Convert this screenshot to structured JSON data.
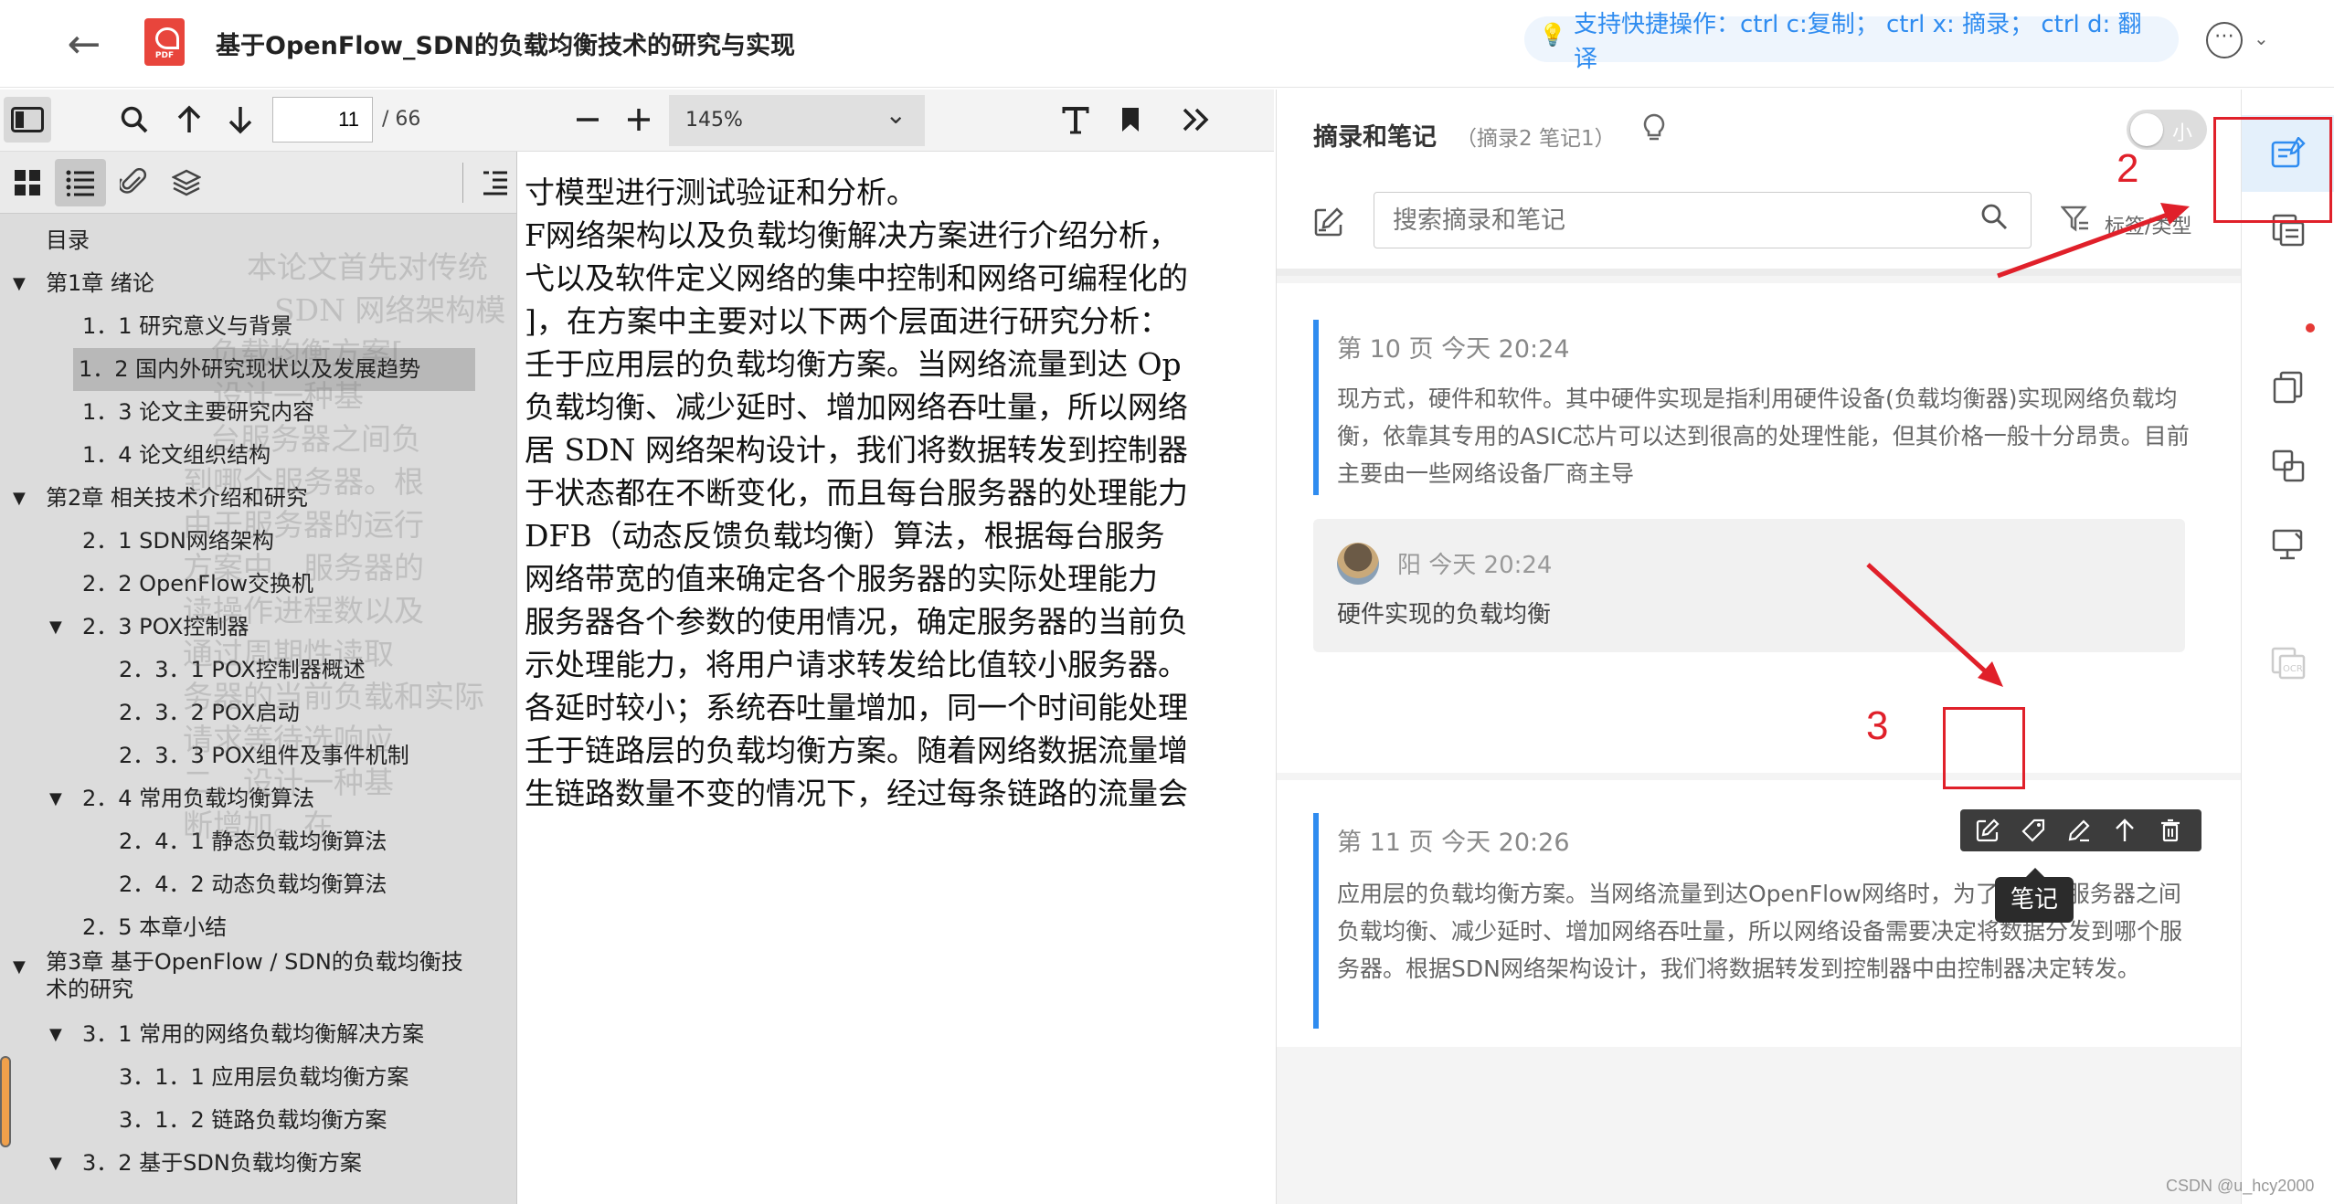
{
  "topbar": {
    "back_label": "←",
    "pdf_badge": "PDF",
    "title": "基于OpenFlow_SDN的负载均衡技术的研究与实现",
    "hint": "支持快捷操作：ctrl c:复制； ctrl x: 摘录； ctrl d: 翻译",
    "more_label": "⋯"
  },
  "pdf_toolbar": {
    "current_page": "11",
    "total_pages": "/ 66",
    "zoom": "145%"
  },
  "toc": {
    "heading": "目录",
    "items": [
      {
        "label": "第1章 绪论",
        "level": 0,
        "caret": "▼"
      },
      {
        "label": "1．1 研究意义与背景",
        "level": 1,
        "caret": ""
      },
      {
        "label": "1．2 国内外研究现状以及发展趋势",
        "level": 1,
        "caret": "",
        "active": true
      },
      {
        "label": "1．3 论文主要研究内容",
        "level": 1,
        "caret": ""
      },
      {
        "label": "1．4 论文组织结构",
        "level": 1,
        "caret": ""
      },
      {
        "label": "第2章 相关技术介绍和研究",
        "level": 0,
        "caret": "▼"
      },
      {
        "label": "2．1 SDN网络架构",
        "level": 1,
        "caret": ""
      },
      {
        "label": "2．2 OpenFlow交换机",
        "level": 1,
        "caret": ""
      },
      {
        "label": "2．3 POX控制器",
        "level": 1,
        "caret": "▼"
      },
      {
        "label": "2．3．1 POX控制器概述",
        "level": 2,
        "caret": ""
      },
      {
        "label": "2．3．2 POX启动",
        "level": 2,
        "caret": ""
      },
      {
        "label": "2．3．3 POX组件及事件机制",
        "level": 2,
        "caret": ""
      },
      {
        "label": "2．4 常用负载均衡算法",
        "level": 1,
        "caret": "▼"
      },
      {
        "label": "2．4．1 静态负载均衡算法",
        "level": 2,
        "caret": ""
      },
      {
        "label": "2．4．2 动态负载均衡算法",
        "level": 2,
        "caret": ""
      },
      {
        "label": "2．5 本章小结",
        "level": 1,
        "caret": ""
      },
      {
        "label": "第3章 基于OpenFlow / SDN的负载均衡技",
        "label2": "术的研究",
        "level": 0,
        "caret": "▼",
        "multi": true
      },
      {
        "label": "3．1 常用的网络负载均衡解决方案",
        "level": 1,
        "caret": "▼"
      },
      {
        "label": "3．1．1 应用层负载均衡方案",
        "level": 2,
        "caret": ""
      },
      {
        "label": "3．1．2 链路负载均衡方案",
        "level": 2,
        "caret": ""
      },
      {
        "label": "3．2 基于SDN负载均衡方案",
        "level": 1,
        "caret": "▼"
      }
    ]
  },
  "pdf_content": {
    "lines": [
      "寸模型进行测试验证和分析。",
      "F网络架构以及负载均衡解决方案进行介绍分析，",
      "弋以及软件定义网络的集中控制和网络可编程化的",
      "]，在方案中主要对以下两个层面进行研究分析：",
      "壬于应用层的负载均衡方案。当网络流量到达 Op",
      "负载均衡、减少延时、增加网络吞吐量，所以网络",
      "居 SDN 网络架构设计，我们将数据转发到控制器",
      "于状态都在不断变化，而且每台服务器的处理能力",
      "DFB（动态反馈负载均衡）算法，根据每台服务",
      "网络带宽的值来确定各个服务器的实际处理能力",
      "服务器各个参数的使用情况，确定服务器的当前负",
      "示处理能力，将用户请求转发给比值较小服务器。",
      "各延时较小；系统吞吐量增加，同一个时间能处理",
      "壬于链路层的负载均衡方案。随着网络数据流量增",
      "生链路数量不变的情况下，经过每条链路的流量会"
    ],
    "ghost_lines": [
      "本论文首先对传统",
      "SDN 网络架构模",
      "负载均衡方案[",
      "，设计一种基",
      "台服务器之间负",
      "到哪个服务器。根",
      "由于服务器的运行",
      "方案中，服务器的",
      "读操作进程数以及",
      "通过周期性读取",
      "务器的当前负载和实际",
      "请求等待选响应",
      "二，设计一种基",
      "断增加。在"
    ]
  },
  "notes": {
    "title": "摘录和笔记",
    "count": "（摘录2  笔记1）",
    "toggle_label": "小",
    "search_placeholder": "搜索摘录和笔记",
    "filter_label": "标签/类型",
    "cards": [
      {
        "meta": "第 10 页   今天 20:24",
        "text": "现方式，硬件和软件。其中硬件实现是指利用硬件设备(负载均衡器)实现网络负载均衡，依靠其专用的ASIC芯片可以达到很高的处理性能，但其价格一般十分昂贵。目前主要由一些网络设备厂商主导",
        "comment": {
          "author_time": "阳 今天 20:24",
          "text": "硬件实现的负载均衡"
        }
      },
      {
        "meta": "第 11 页   今天 20:26",
        "text": "应用层的负载均衡方案。当网络流量到达OpenFlow网络时，为了使后台服务器之间负载均衡、减少延时、增加网络吞吐量，所以网络设备需要决定将数据分发到哪个服务器。根据SDN网络架构设计，我们将数据转发到控制器中由控制器决定转发。"
      }
    ],
    "tooltip": "笔记"
  },
  "annotations": {
    "num2": "2",
    "num3": "3",
    "color": "#e0202a"
  },
  "watermark": "CSDN @u_hcy2000",
  "colors": {
    "accent": "#2f8cf0",
    "pdf_red": "#e8453c",
    "annotation_red": "#e0202a"
  }
}
